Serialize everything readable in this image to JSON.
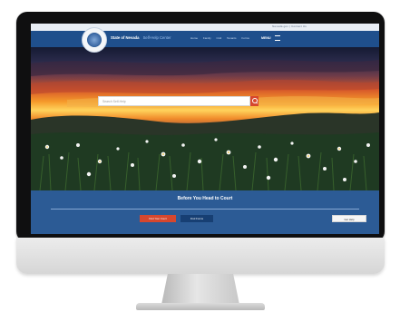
{
  "top_bar": {
    "links_text": "Nevada.gov  |  Contact Us"
  },
  "header": {
    "site_title": "State of Nevada",
    "site_subtitle": "Self-Help Center",
    "nav_items": [
      "Home",
      "Family",
      "Civil",
      "Tenants",
      "Forms"
    ],
    "menu_label": "MENU"
  },
  "search": {
    "placeholder": "Search Self-Help"
  },
  "info_band": {
    "title": "Before You Head to Court",
    "primary_button": "Find Your Court",
    "secondary_button": "Find Forms",
    "right_button": "Get Help"
  },
  "colors": {
    "nav_blue": "#1f4f8c",
    "band_blue": "#2c5b95",
    "accent_red": "#d6472e"
  },
  "icons": [
    "state-seal-icon",
    "menu-icon",
    "search-icon"
  ]
}
